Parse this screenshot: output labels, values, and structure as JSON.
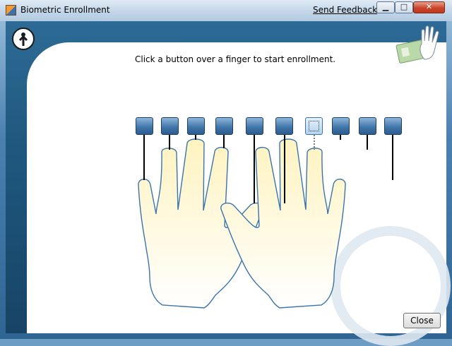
{
  "window": {
    "title": "Biometric Enrollment",
    "send_feedback": "Send Feedback",
    "minimize": "▁",
    "maximize": "□",
    "close": "✕"
  },
  "main": {
    "instruction": "Click a button over a finger to start enrollment.",
    "close_button": "Close"
  },
  "fingers": [
    {
      "id": "left-pinky",
      "selected": false
    },
    {
      "id": "left-ring",
      "selected": false
    },
    {
      "id": "left-middle",
      "selected": false
    },
    {
      "id": "left-index",
      "selected": false
    },
    {
      "id": "left-thumb",
      "selected": false
    },
    {
      "id": "right-thumb",
      "selected": false
    },
    {
      "id": "right-index",
      "selected": true
    },
    {
      "id": "right-middle",
      "selected": false
    },
    {
      "id": "right-ring",
      "selected": false
    },
    {
      "id": "right-pinky",
      "selected": false
    }
  ],
  "icons": [
    "app-icon",
    "logo-icon",
    "hand-id-card-icon",
    "watermark-logo-icon"
  ],
  "colors": {
    "header_blue": "#2d6b96",
    "button_blue": "#3e73a6",
    "hand_outline": "#3a74ad",
    "finger_fill": "#fff7cc"
  }
}
